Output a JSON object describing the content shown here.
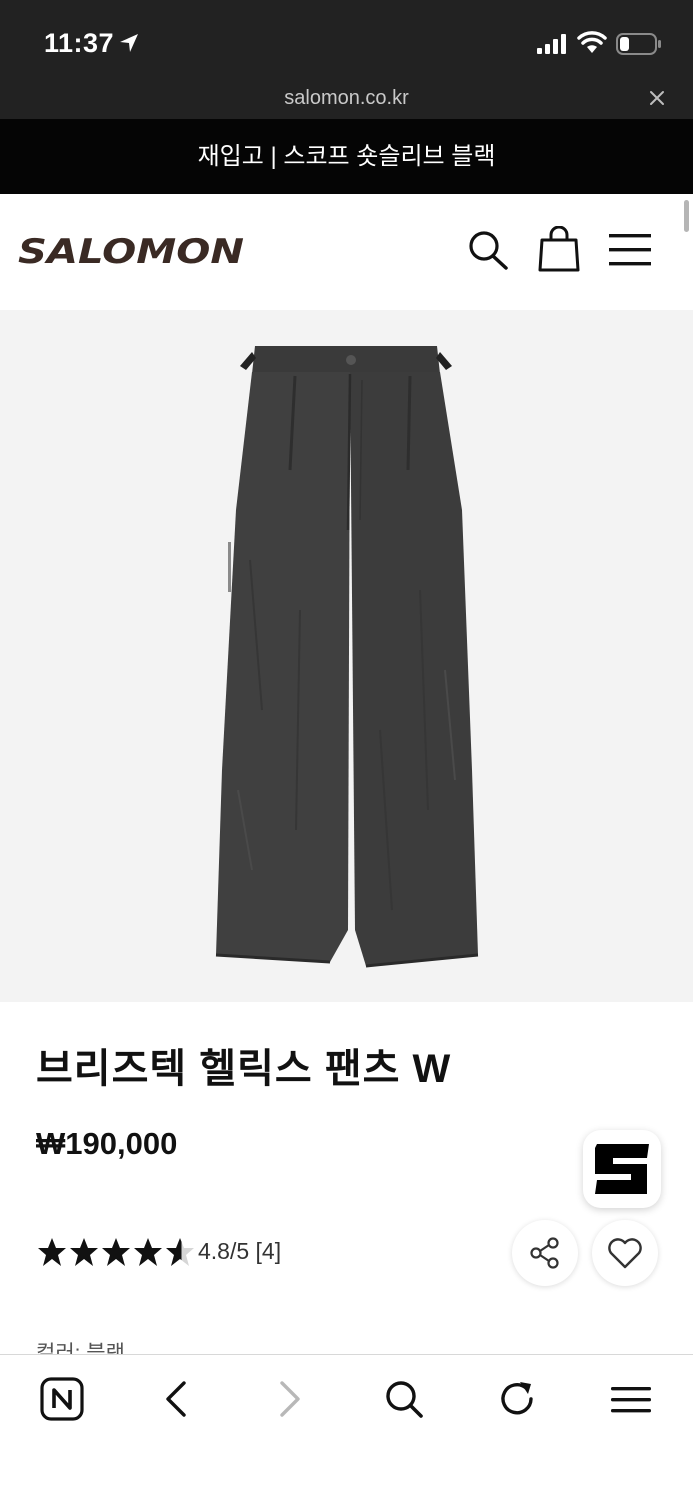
{
  "status_bar": {
    "time": "11:37",
    "icons": [
      "location-arrow-icon",
      "signal-icon",
      "wifi-icon",
      "battery-icon"
    ]
  },
  "browser_url": {
    "domain": "salomon.co.kr",
    "close_icon": "close-icon"
  },
  "promo_banner": {
    "text": "재입고 | 스코프 숏슬리브 블랙"
  },
  "site_header": {
    "logo_text": "SALOMON",
    "icons": [
      "search-icon",
      "shopping-bag-icon",
      "hamburger-menu-icon"
    ]
  },
  "product": {
    "image_alt": "black wide pleated pants",
    "title": "브리즈텍 헬릭스 팬츠 W",
    "price": "₩190,000",
    "rating_value": 4.8,
    "rating_text": "4.8/5 [4]",
    "partial_label": "컬러: 블랙"
  },
  "floating_buttons": {
    "brand_badge": "s-logo-icon",
    "share": "share-icon",
    "wishlist": "heart-icon"
  },
  "browser_toolbar": {
    "icons": [
      "naver-home-icon",
      "back-icon",
      "forward-icon",
      "search-icon",
      "refresh-icon",
      "menu-icon"
    ]
  },
  "colors": {
    "status_bar_bg": "#222222",
    "banner_bg": "#050505",
    "logo_color": "#3a2a24",
    "image_bg": "#f3f3f3",
    "star_color": "#111111"
  }
}
